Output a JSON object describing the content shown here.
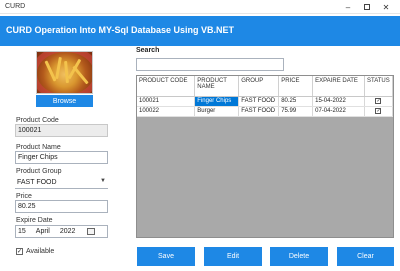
{
  "window": {
    "title": "CURD"
  },
  "header": {
    "title": "CURD Operation Into MY-Sql Database Using VB.NET"
  },
  "form": {
    "browse_label": "Browse",
    "product_code": {
      "label": "Product Code",
      "value": "100021"
    },
    "product_name": {
      "label": "Product Name",
      "value": "Finger Chips"
    },
    "product_group": {
      "label": "Product Group",
      "value": "FAST FOOD"
    },
    "price": {
      "label": "Price",
      "value": "80.25"
    },
    "expire_date": {
      "label": "Expire Date",
      "day": "15",
      "month": "April",
      "year": "2022"
    },
    "available": {
      "label": "Available",
      "checked": true
    }
  },
  "search": {
    "label": "Search",
    "value": ""
  },
  "table": {
    "columns": [
      "PRODUCT CODE",
      "PRODUCT NAME",
      "GROUP",
      "PRICE",
      "EXPAIRE DATE",
      "STATUS"
    ],
    "rows": [
      {
        "code": "100021",
        "name": "Finger Chips",
        "group": "FAST FOOD",
        "price": "80.25",
        "date": "15-04-2022",
        "status": true
      },
      {
        "code": "100022",
        "name": "Burger",
        "group": "FAST FOOD",
        "price": "75.99",
        "date": "07-04-2022",
        "status": true
      }
    ]
  },
  "buttons": {
    "save": "Save",
    "edit": "Edit",
    "delete": "Delete",
    "clear": "Clear"
  },
  "colors": {
    "accent": "#1e88e5",
    "selection": "#0078d7",
    "grid_background": "#a9a9a9"
  }
}
